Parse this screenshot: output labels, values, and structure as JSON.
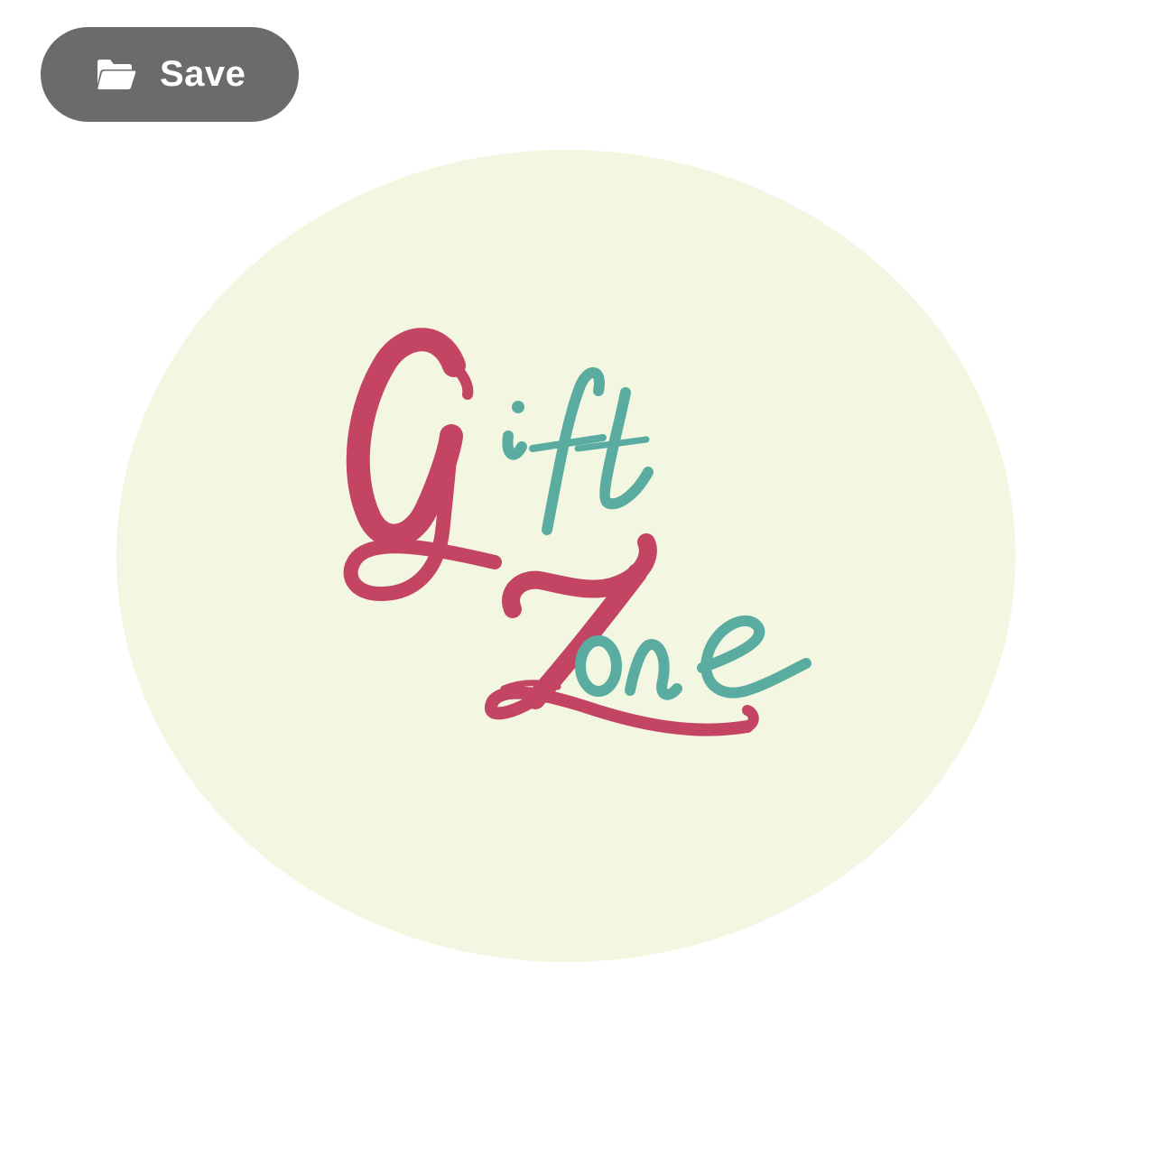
{
  "toolbar": {
    "save_label": "Save",
    "save_icon": "folder-icon",
    "button_color": "#6b6b6b"
  },
  "logo": {
    "text_word1": "Gift",
    "text_word2": "Zone",
    "background_color": "#f3f7e2",
    "primary_color": "#c44464",
    "secondary_color": "#5aaba0"
  }
}
